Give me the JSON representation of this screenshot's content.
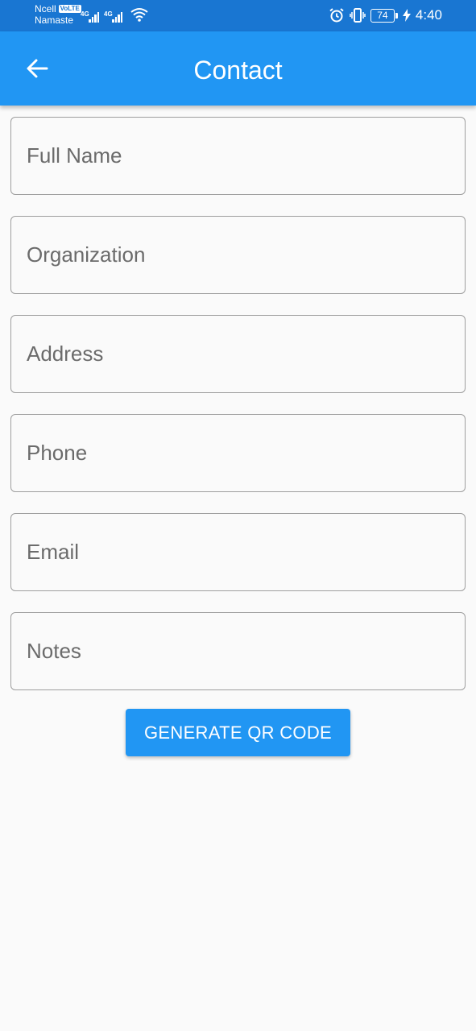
{
  "status_bar": {
    "carrier": "Ncell",
    "volte": "VoLTE",
    "network_name": "Namaste",
    "signal1_tag": "4G",
    "signal2_tag": "4G",
    "battery": "74",
    "time": "4:40"
  },
  "app_bar": {
    "title": "Contact",
    "back_icon": "arrow-left-icon"
  },
  "form": {
    "fields": [
      {
        "placeholder": "Full Name",
        "value": ""
      },
      {
        "placeholder": "Organization",
        "value": ""
      },
      {
        "placeholder": "Address",
        "value": ""
      },
      {
        "placeholder": "Phone",
        "value": ""
      },
      {
        "placeholder": "Email",
        "value": ""
      },
      {
        "placeholder": "Notes",
        "value": ""
      }
    ],
    "submit_label": "GENERATE QR CODE"
  },
  "colors": {
    "status_bar": "#1976d2",
    "app_bar": "#2196f3",
    "button": "#2196f3",
    "background": "#fafafa"
  }
}
